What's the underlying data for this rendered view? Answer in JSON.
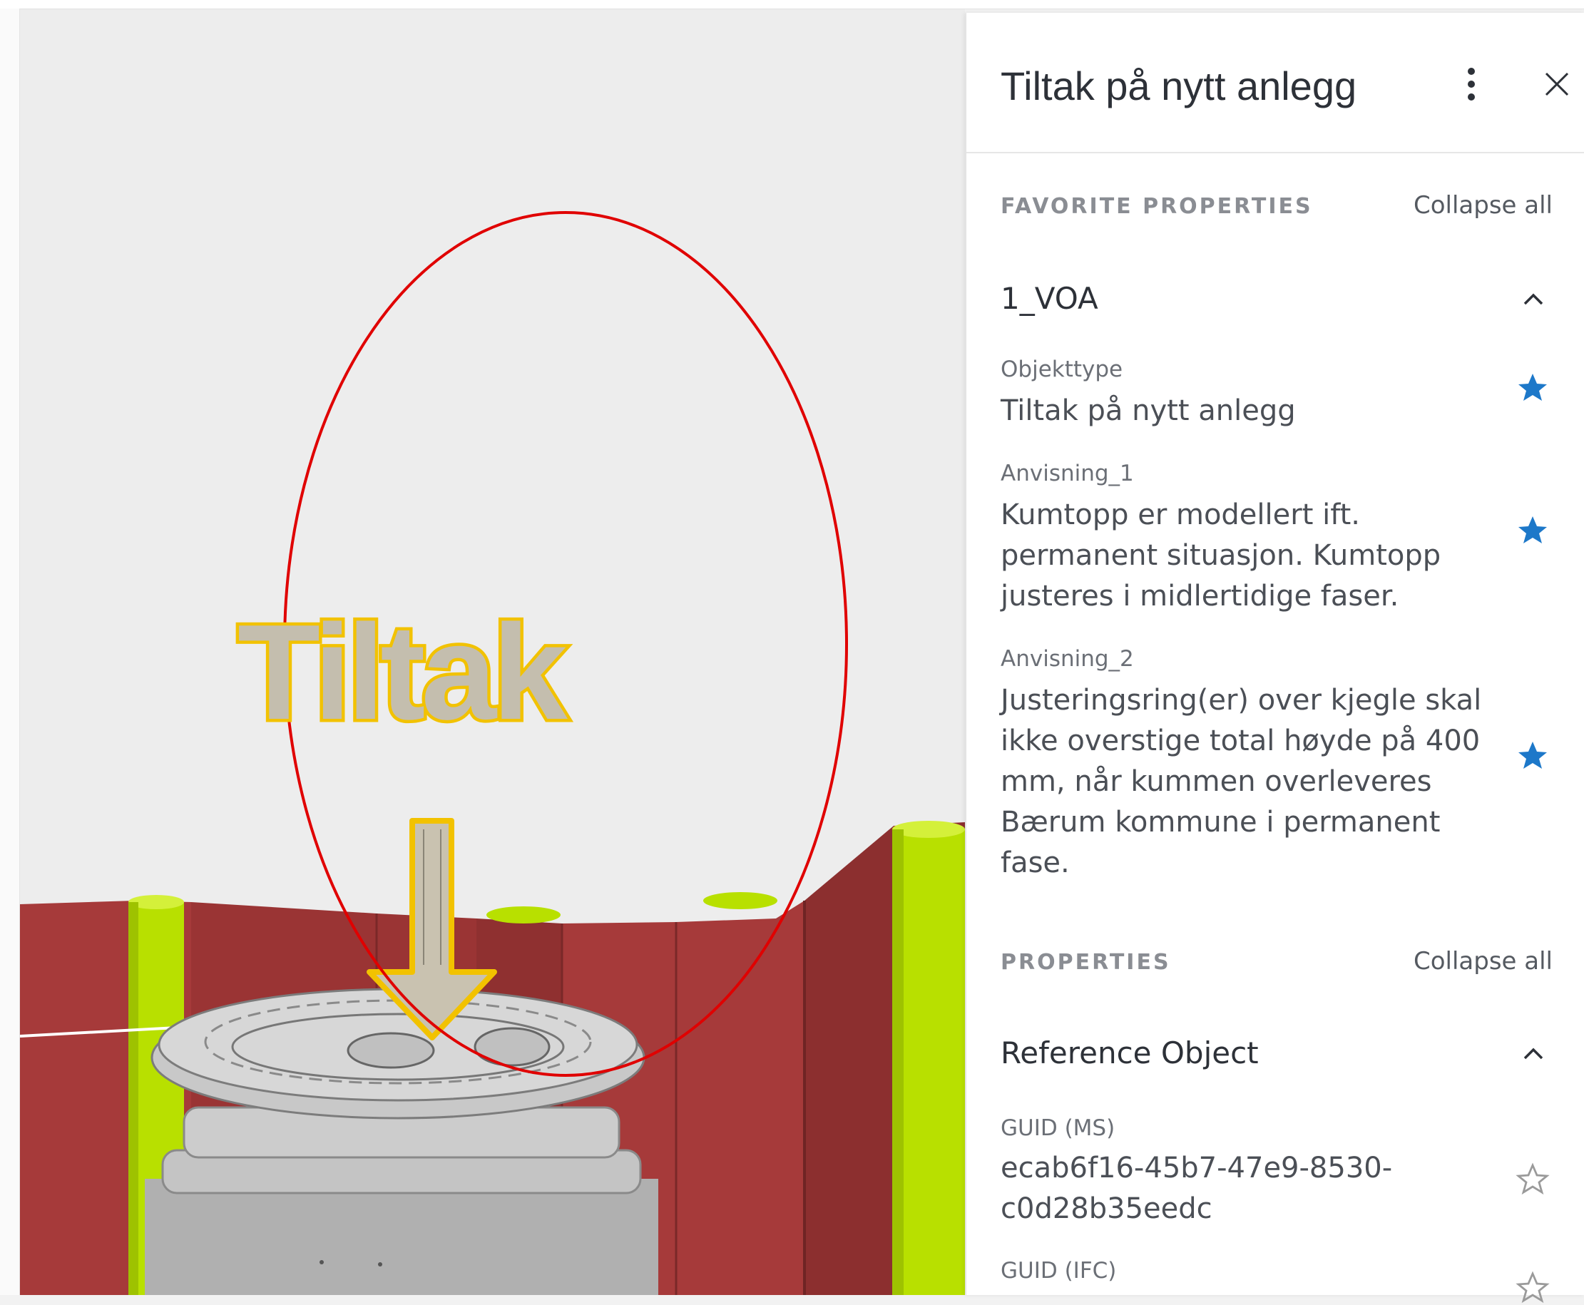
{
  "panel": {
    "title": "Tiltak på nytt anlegg",
    "more_icon": "more-vertical-icon",
    "close_icon": "close-icon",
    "favorite_section": {
      "label": "FAVORITE PROPERTIES",
      "collapse_label": "Collapse all",
      "group": {
        "title": "1_VOA",
        "expanded": true,
        "properties": [
          {
            "name": "Objekttype",
            "value": "Tiltak på nytt anlegg",
            "favorite": true
          },
          {
            "name": "Anvisning_1",
            "value": "Kumtopp er modellert ift. permanent situasjon. Kumtopp justeres i midlertidige faser.",
            "favorite": true
          },
          {
            "name": "Anvisning_2",
            "value": "Justeringsring(er) over kjegle skal ikke overstige total høyde på 400 mm, når kummen overleveres Bærum kommune i permanent fase.",
            "favorite": true
          }
        ]
      }
    },
    "properties_section": {
      "label": "PROPERTIES",
      "collapse_label": "Collapse all",
      "group": {
        "title": "Reference Object",
        "expanded": true,
        "properties": [
          {
            "name": "GUID (MS)",
            "value": "ecab6f16-45b7-47e9-8530-c0d28b35eedc",
            "favorite": false
          },
          {
            "name": "GUID (IFC)",
            "value": "",
            "favorite": false
          }
        ]
      }
    }
  },
  "viewport": {
    "model_label": "Tiltak",
    "colors": {
      "background": "#ededed",
      "wall": "#a63a3a",
      "pipe": "#b8e000",
      "manhole": "#bdbdbd",
      "highlight": "#f2c200",
      "annotation_ellipse": "#e00000",
      "favorite_star": "#1d78c9"
    }
  }
}
